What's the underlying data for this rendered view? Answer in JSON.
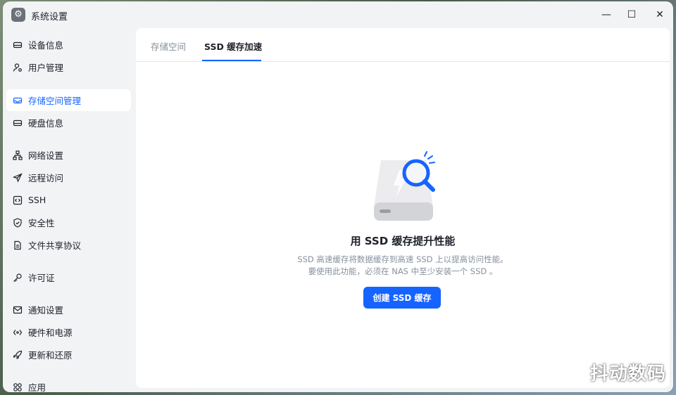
{
  "window": {
    "title": "系统设置",
    "app_icon": "gear-icon"
  },
  "controls": {
    "minimize": "—",
    "maximize": "☐",
    "close": "✕"
  },
  "sidebar": {
    "items": [
      {
        "label": "设备信息",
        "icon": "drive-icon",
        "active": false
      },
      {
        "label": "用户管理",
        "icon": "user-gear-icon",
        "active": false
      },
      {
        "label": "存储空间管理",
        "icon": "storage-icon",
        "active": true
      },
      {
        "label": "硬盘信息",
        "icon": "drive-icon",
        "active": false
      },
      {
        "label": "网络设置",
        "icon": "network-icon",
        "active": false
      },
      {
        "label": "远程访问",
        "icon": "send-icon",
        "active": false
      },
      {
        "label": "SSH",
        "icon": "terminal-icon",
        "active": false
      },
      {
        "label": "安全性",
        "icon": "shield-icon",
        "active": false
      },
      {
        "label": "文件共享协议",
        "icon": "document-icon",
        "active": false
      },
      {
        "label": "许可证",
        "icon": "key-icon",
        "active": false
      },
      {
        "label": "通知设置",
        "icon": "mail-icon",
        "active": false
      },
      {
        "label": "硬件和电源",
        "icon": "hardware-icon",
        "active": false
      },
      {
        "label": "更新和还原",
        "icon": "rocket-icon",
        "active": false
      },
      {
        "label": "应用",
        "icon": "apps-icon",
        "active": false
      }
    ]
  },
  "tabs": [
    {
      "label": "存储空间",
      "active": false
    },
    {
      "label": "SSD 缓存加速",
      "active": true
    }
  ],
  "empty_state": {
    "title": "用 SSD 缓存提升性能",
    "desc_line1": "SSD 高速缓存将数据缓存到高速 SSD 上以提高访问性能。",
    "desc_line2": "要使用此功能，必须在 NAS 中至少安装一个 SSD 。",
    "button_label": "创建 SSD 缓存"
  },
  "watermark": "抖动数码",
  "colors": {
    "accent": "#1664ff",
    "text": "#1d2129",
    "muted": "#86909c",
    "background": "#f2f3f5"
  }
}
